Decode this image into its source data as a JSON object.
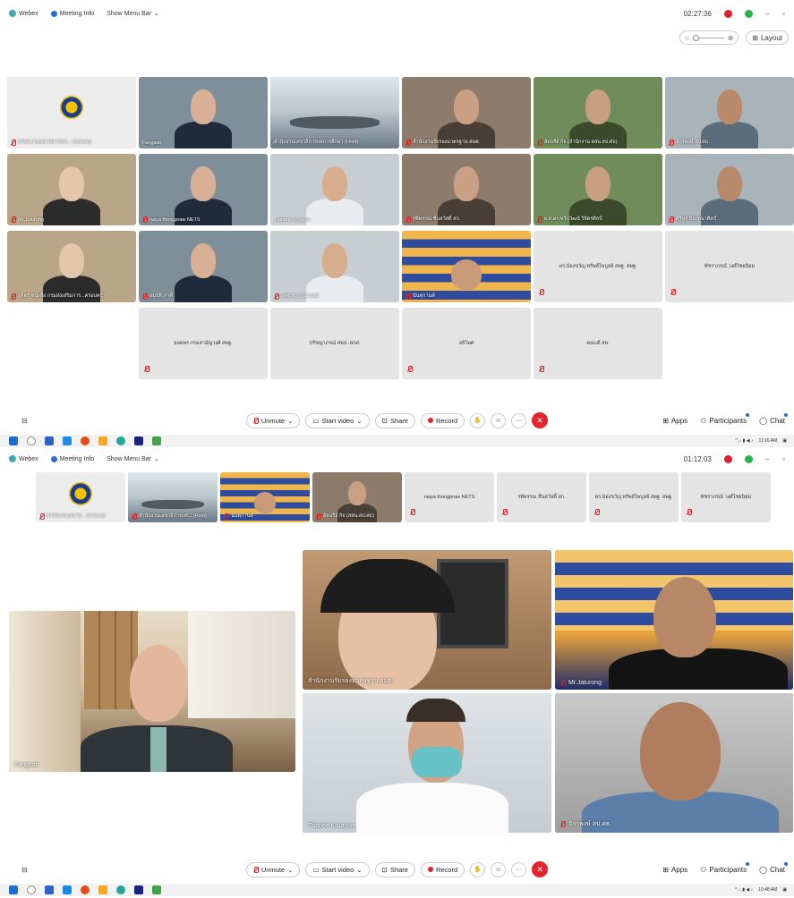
{
  "screen1": {
    "topbar": {
      "app": "Webex",
      "meeting_info": "Meeting Info",
      "menu_bar": "Show Menu Bar",
      "timer": "02:27:36"
    },
    "view": {
      "layout": "Layout"
    },
    "tiles": [
      {
        "name": "สำนักงานเลขาธิการกศ... (Cohost)",
        "kind": "logo",
        "muted": true
      },
      {
        "name": "Fangsan",
        "kind": "video",
        "muted": false,
        "active": true
      },
      {
        "name": "สำนักงานเลขาธิการกศการศึกษา (Host)",
        "kind": "room",
        "muted": false,
        "active": true
      },
      {
        "name": "สำนักงานรับรองมาตรฐาน สมศ.",
        "kind": "video",
        "muted": true
      },
      {
        "name": "อัจฉรีย์ กิจ (สำนักงาน สสน.สป.ศธ)",
        "kind": "video",
        "muted": true
      },
      {
        "name": "จักรพงษ์ สป.ศธ.",
        "kind": "video",
        "muted": true
      },
      {
        "name": "Mr.Jaturong",
        "kind": "video",
        "muted": true
      },
      {
        "name": "naiya thongpraw NETS",
        "kind": "video",
        "muted": true
      },
      {
        "name": "Thanee Kruayoo",
        "kind": "video",
        "muted": false
      },
      {
        "name": "รพีพรรณ ชื่นสวัสดิ์ สก.",
        "kind": "video",
        "muted": true
      },
      {
        "name": "ผ.ศ.ดร.ทวีปวัฒน์ วิจิตรศิลป์",
        "kind": "video",
        "muted": true
      },
      {
        "name": "ศิริพร มัณฑนาศิลป์",
        "kind": "video",
        "muted": true
      },
      {
        "name": "สุจิตร์ หนังสือ กรมส่งเสริมการ...ครอบครัว",
        "kind": "video",
        "muted": true
      },
      {
        "name": "สมบัติ ภาคี",
        "kind": "video",
        "muted": true
      },
      {
        "name": "สพฐ.สป_สนามชัย",
        "kind": "video",
        "muted": true
      },
      {
        "name": "นันทุกานต์",
        "kind": "banner",
        "muted": true
      },
      {
        "name": "ดร.น้องขวัญ ทรัพย์ไพบูลย์ สพฐ. สพฐ.",
        "kind": "blank",
        "muted": true
      },
      {
        "name": "พัชราภรณ์ วงศ์ไชยนิยม",
        "kind": "blank",
        "muted": true
      },
      {
        "name": "",
        "kind": "empty",
        "muted": false
      },
      {
        "name": "ยอดพร กรมสามัญวงศ์ สพฐ.",
        "kind": "blank",
        "muted": true
      },
      {
        "name": "ปรัชญาภรณ์ สพป.-สกศ.",
        "kind": "blank",
        "muted": false
      },
      {
        "name": "อธิไพศ",
        "kind": "blank",
        "muted": true
      },
      {
        "name": "คณะดี สพ.",
        "kind": "blank",
        "muted": true
      }
    ],
    "controls": {
      "unmute": "Unmute",
      "start_video": "Start video",
      "share": "Share",
      "record": "Record",
      "apps": "Apps",
      "participants": "Participants",
      "chat": "Chat"
    },
    "taskbar": {
      "time": "11:16 AM"
    }
  },
  "screen2": {
    "topbar": {
      "app": "Webex",
      "meeting_info": "Meeting Info",
      "menu_bar": "Show Menu Bar",
      "timer": "01:12:03"
    },
    "strip": [
      {
        "name": "สำนักงานเลขาธิ... (Cohost)",
        "kind": "logo"
      },
      {
        "name": "สำนักงานเลขาธิการกศ... (Host)",
        "kind": "room"
      },
      {
        "name": "นันทุกานต์",
        "kind": "banner"
      },
      {
        "name": "อัจฉรีย์ กิจ (สสน.สป.ศธ)",
        "kind": "video"
      },
      {
        "name": "naiya thongpraw NETS",
        "kind": "blank"
      },
      {
        "name": "รพีพรรณ ชื่นสวัสดิ์ สก.",
        "kind": "blank"
      },
      {
        "name": "ดร.น้องขวัญ ทรัพย์ไพบูลย์ สพฐ. สพฐ.",
        "kind": "blank"
      },
      {
        "name": "พัชราภรณ์ วงศ์ไชยนิยม",
        "kind": "blank"
      }
    ],
    "big": {
      "main": "Fangsan",
      "t1": "สำนักงานรับรองมาตรฐาน สมศ.",
      "t2": "Mr.Jaturong",
      "t3": "Thanee Kruayoo",
      "t4": "จักรพงษ์ สป.ศธ."
    },
    "controls": {
      "unmute": "Unmute",
      "start_video": "Start video",
      "share": "Share",
      "record": "Record",
      "apps": "Apps",
      "participants": "Participants",
      "chat": "Chat"
    },
    "taskbar": {
      "time": "10:48 AM"
    }
  }
}
